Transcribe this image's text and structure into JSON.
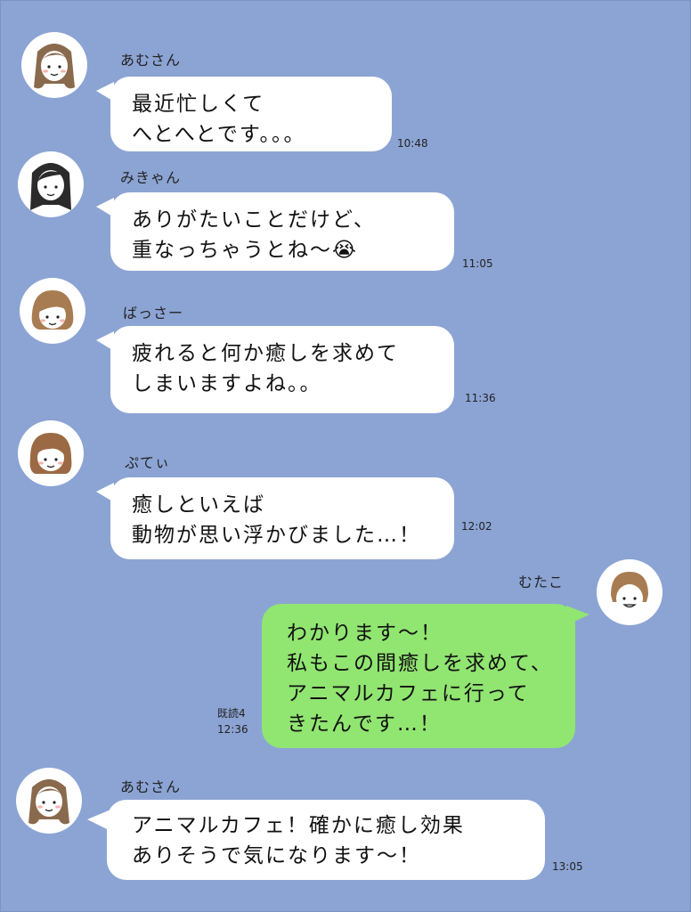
{
  "messages": [
    {
      "sender": "あむさん",
      "lines": [
        "最近忙しくて",
        "へとへとです。。。"
      ],
      "time": "10:48"
    },
    {
      "sender": "みきゃん",
      "lines": [
        "ありがたいことだけど、",
        "重なっちゃうとね〜😭"
      ],
      "time": "11:05"
    },
    {
      "sender": "ばっさー",
      "lines": [
        "疲れると何か癒しを求めて",
        "しまいますよね。。"
      ],
      "time": "11:36"
    },
    {
      "sender": "ぷてぃ",
      "lines": [
        "癒しといえば",
        "動物が思い浮かびました…！"
      ],
      "time": "12:02"
    },
    {
      "sender": "むたこ",
      "lines": [
        "わかります〜！",
        "私もこの間癒しを求めて、",
        "アニマルカフェに行って",
        "きたんです…！"
      ],
      "time": "12:36",
      "read": "既読4"
    },
    {
      "sender": "あむさん",
      "lines": [
        "アニマルカフェ！確かに癒し効果",
        "ありそうで気になります〜！"
      ],
      "time": "13:05"
    }
  ],
  "colors": {
    "background": "#8ca4d4",
    "incoming_bubble": "#ffffff",
    "outgoing_bubble": "#91e571"
  },
  "avatars": [
    "amu-avatar",
    "mikyan-avatar",
    "bassa-avatar",
    "puti-avatar",
    "mutako-avatar",
    "amu-avatar"
  ]
}
